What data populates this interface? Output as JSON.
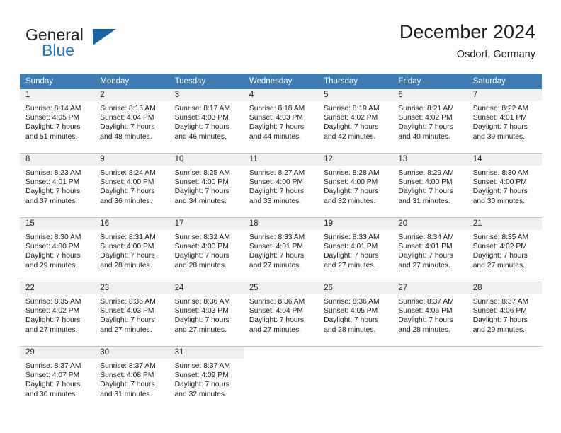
{
  "brand": {
    "name_top": "General",
    "name_bottom": "Blue",
    "triangle_color": "#1565a8",
    "blue_color": "#1f7ac4"
  },
  "header": {
    "title": "December 2024",
    "subtitle": "Osdorf, Germany"
  },
  "theme": {
    "header_bg": "#3d7cb5",
    "header_text": "#ffffff",
    "daynum_band_bg": "#f0f0f0",
    "row_divider": "#bfbfbf"
  },
  "labels": {
    "sunrise_prefix": "Sunrise:",
    "sunset_prefix": "Sunset:",
    "daylight_prefix": "Daylight:"
  },
  "weekday_headers": [
    "Sunday",
    "Monday",
    "Tuesday",
    "Wednesday",
    "Thursday",
    "Friday",
    "Saturday"
  ],
  "weeks": [
    [
      {
        "day": "1",
        "sunrise": "Sunrise: 8:14 AM",
        "sunset": "Sunset: 4:05 PM",
        "daylight_line1": "Daylight: 7 hours",
        "daylight_line2": "and 51 minutes."
      },
      {
        "day": "2",
        "sunrise": "Sunrise: 8:15 AM",
        "sunset": "Sunset: 4:04 PM",
        "daylight_line1": "Daylight: 7 hours",
        "daylight_line2": "and 48 minutes."
      },
      {
        "day": "3",
        "sunrise": "Sunrise: 8:17 AM",
        "sunset": "Sunset: 4:03 PM",
        "daylight_line1": "Daylight: 7 hours",
        "daylight_line2": "and 46 minutes."
      },
      {
        "day": "4",
        "sunrise": "Sunrise: 8:18 AM",
        "sunset": "Sunset: 4:03 PM",
        "daylight_line1": "Daylight: 7 hours",
        "daylight_line2": "and 44 minutes."
      },
      {
        "day": "5",
        "sunrise": "Sunrise: 8:19 AM",
        "sunset": "Sunset: 4:02 PM",
        "daylight_line1": "Daylight: 7 hours",
        "daylight_line2": "and 42 minutes."
      },
      {
        "day": "6",
        "sunrise": "Sunrise: 8:21 AM",
        "sunset": "Sunset: 4:02 PM",
        "daylight_line1": "Daylight: 7 hours",
        "daylight_line2": "and 40 minutes."
      },
      {
        "day": "7",
        "sunrise": "Sunrise: 8:22 AM",
        "sunset": "Sunset: 4:01 PM",
        "daylight_line1": "Daylight: 7 hours",
        "daylight_line2": "and 39 minutes."
      }
    ],
    [
      {
        "day": "8",
        "sunrise": "Sunrise: 8:23 AM",
        "sunset": "Sunset: 4:01 PM",
        "daylight_line1": "Daylight: 7 hours",
        "daylight_line2": "and 37 minutes."
      },
      {
        "day": "9",
        "sunrise": "Sunrise: 8:24 AM",
        "sunset": "Sunset: 4:00 PM",
        "daylight_line1": "Daylight: 7 hours",
        "daylight_line2": "and 36 minutes."
      },
      {
        "day": "10",
        "sunrise": "Sunrise: 8:25 AM",
        "sunset": "Sunset: 4:00 PM",
        "daylight_line1": "Daylight: 7 hours",
        "daylight_line2": "and 34 minutes."
      },
      {
        "day": "11",
        "sunrise": "Sunrise: 8:27 AM",
        "sunset": "Sunset: 4:00 PM",
        "daylight_line1": "Daylight: 7 hours",
        "daylight_line2": "and 33 minutes."
      },
      {
        "day": "12",
        "sunrise": "Sunrise: 8:28 AM",
        "sunset": "Sunset: 4:00 PM",
        "daylight_line1": "Daylight: 7 hours",
        "daylight_line2": "and 32 minutes."
      },
      {
        "day": "13",
        "sunrise": "Sunrise: 8:29 AM",
        "sunset": "Sunset: 4:00 PM",
        "daylight_line1": "Daylight: 7 hours",
        "daylight_line2": "and 31 minutes."
      },
      {
        "day": "14",
        "sunrise": "Sunrise: 8:30 AM",
        "sunset": "Sunset: 4:00 PM",
        "daylight_line1": "Daylight: 7 hours",
        "daylight_line2": "and 30 minutes."
      }
    ],
    [
      {
        "day": "15",
        "sunrise": "Sunrise: 8:30 AM",
        "sunset": "Sunset: 4:00 PM",
        "daylight_line1": "Daylight: 7 hours",
        "daylight_line2": "and 29 minutes."
      },
      {
        "day": "16",
        "sunrise": "Sunrise: 8:31 AM",
        "sunset": "Sunset: 4:00 PM",
        "daylight_line1": "Daylight: 7 hours",
        "daylight_line2": "and 28 minutes."
      },
      {
        "day": "17",
        "sunrise": "Sunrise: 8:32 AM",
        "sunset": "Sunset: 4:00 PM",
        "daylight_line1": "Daylight: 7 hours",
        "daylight_line2": "and 28 minutes."
      },
      {
        "day": "18",
        "sunrise": "Sunrise: 8:33 AM",
        "sunset": "Sunset: 4:01 PM",
        "daylight_line1": "Daylight: 7 hours",
        "daylight_line2": "and 27 minutes."
      },
      {
        "day": "19",
        "sunrise": "Sunrise: 8:33 AM",
        "sunset": "Sunset: 4:01 PM",
        "daylight_line1": "Daylight: 7 hours",
        "daylight_line2": "and 27 minutes."
      },
      {
        "day": "20",
        "sunrise": "Sunrise: 8:34 AM",
        "sunset": "Sunset: 4:01 PM",
        "daylight_line1": "Daylight: 7 hours",
        "daylight_line2": "and 27 minutes."
      },
      {
        "day": "21",
        "sunrise": "Sunrise: 8:35 AM",
        "sunset": "Sunset: 4:02 PM",
        "daylight_line1": "Daylight: 7 hours",
        "daylight_line2": "and 27 minutes."
      }
    ],
    [
      {
        "day": "22",
        "sunrise": "Sunrise: 8:35 AM",
        "sunset": "Sunset: 4:02 PM",
        "daylight_line1": "Daylight: 7 hours",
        "daylight_line2": "and 27 minutes."
      },
      {
        "day": "23",
        "sunrise": "Sunrise: 8:36 AM",
        "sunset": "Sunset: 4:03 PM",
        "daylight_line1": "Daylight: 7 hours",
        "daylight_line2": "and 27 minutes."
      },
      {
        "day": "24",
        "sunrise": "Sunrise: 8:36 AM",
        "sunset": "Sunset: 4:03 PM",
        "daylight_line1": "Daylight: 7 hours",
        "daylight_line2": "and 27 minutes."
      },
      {
        "day": "25",
        "sunrise": "Sunrise: 8:36 AM",
        "sunset": "Sunset: 4:04 PM",
        "daylight_line1": "Daylight: 7 hours",
        "daylight_line2": "and 27 minutes."
      },
      {
        "day": "26",
        "sunrise": "Sunrise: 8:36 AM",
        "sunset": "Sunset: 4:05 PM",
        "daylight_line1": "Daylight: 7 hours",
        "daylight_line2": "and 28 minutes."
      },
      {
        "day": "27",
        "sunrise": "Sunrise: 8:37 AM",
        "sunset": "Sunset: 4:06 PM",
        "daylight_line1": "Daylight: 7 hours",
        "daylight_line2": "and 28 minutes."
      },
      {
        "day": "28",
        "sunrise": "Sunrise: 8:37 AM",
        "sunset": "Sunset: 4:06 PM",
        "daylight_line1": "Daylight: 7 hours",
        "daylight_line2": "and 29 minutes."
      }
    ],
    [
      {
        "day": "29",
        "sunrise": "Sunrise: 8:37 AM",
        "sunset": "Sunset: 4:07 PM",
        "daylight_line1": "Daylight: 7 hours",
        "daylight_line2": "and 30 minutes."
      },
      {
        "day": "30",
        "sunrise": "Sunrise: 8:37 AM",
        "sunset": "Sunset: 4:08 PM",
        "daylight_line1": "Daylight: 7 hours",
        "daylight_line2": "and 31 minutes."
      },
      {
        "day": "31",
        "sunrise": "Sunrise: 8:37 AM",
        "sunset": "Sunset: 4:09 PM",
        "daylight_line1": "Daylight: 7 hours",
        "daylight_line2": "and 32 minutes."
      },
      {
        "day": "",
        "sunrise": "",
        "sunset": "",
        "daylight_line1": "",
        "daylight_line2": ""
      },
      {
        "day": "",
        "sunrise": "",
        "sunset": "",
        "daylight_line1": "",
        "daylight_line2": ""
      },
      {
        "day": "",
        "sunrise": "",
        "sunset": "",
        "daylight_line1": "",
        "daylight_line2": ""
      },
      {
        "day": "",
        "sunrise": "",
        "sunset": "",
        "daylight_line1": "",
        "daylight_line2": ""
      }
    ]
  ]
}
